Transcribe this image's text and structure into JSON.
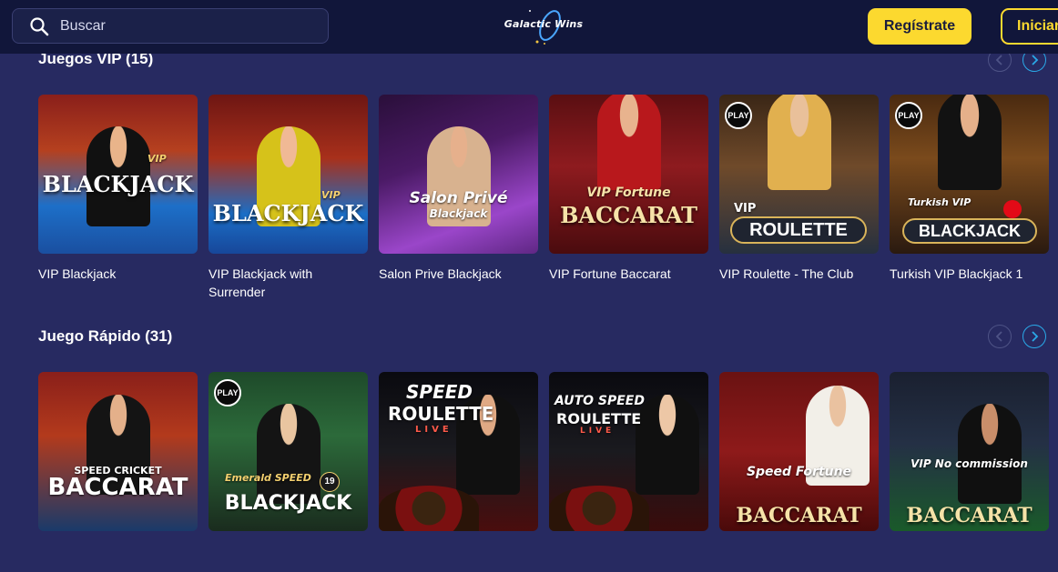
{
  "header": {
    "search_placeholder": "Buscar",
    "logo_text": "Galactic Wins",
    "register_label": "Regístrate",
    "login_label": "Iniciar"
  },
  "colors": {
    "header_bg": "#11163a",
    "page_bg": "#272a61",
    "accent_yellow": "#fcd92f",
    "arrow_active": "#2aa9e8"
  },
  "sections": [
    {
      "title": "Juegos VIP (15)",
      "games": [
        {
          "title": "VIP Blackjack",
          "overlay": "BLACKJACK",
          "badge": "VIP"
        },
        {
          "title": "VIP Blackjack with Surrender",
          "overlay": "BLACKJACK",
          "badge": "VIP"
        },
        {
          "title": "Salon Prive Blackjack",
          "overlay": "Salon Privé",
          "overlay_sub": "Blackjack"
        },
        {
          "title": "VIP Fortune Baccarat",
          "overlay": "BACCARAT",
          "overlay_sub": "VIP Fortune"
        },
        {
          "title": "VIP Roulette - The Club",
          "overlay": "ROULETTE",
          "badge": "VIP",
          "play": "PLAY"
        },
        {
          "title": "Turkish VIP Blackjack 1",
          "overlay": "BLACKJACK",
          "overlay_sub": "Turkish VIP",
          "play": "PLAY"
        }
      ]
    },
    {
      "title": "Juego Rápido (31)",
      "games": [
        {
          "overlay": "BACCARAT",
          "overlay_sub": "SPEED CRICKET"
        },
        {
          "overlay": "BLACKJACK",
          "overlay_sub": "Emerald SPEED",
          "play": "PLAY",
          "badge": "19"
        },
        {
          "overlay": "ROULETTE",
          "overlay_sub": "SPEED",
          "overlay_live": "LIVE"
        },
        {
          "overlay": "ROULETTE",
          "overlay_sub": "AUTO SPEED",
          "overlay_live": "LIVE"
        },
        {
          "overlay": "BACCARAT",
          "overlay_sub": "Speed Fortune"
        },
        {
          "overlay": "BACCARAT",
          "overlay_sub": "VIP No commission"
        }
      ]
    }
  ]
}
